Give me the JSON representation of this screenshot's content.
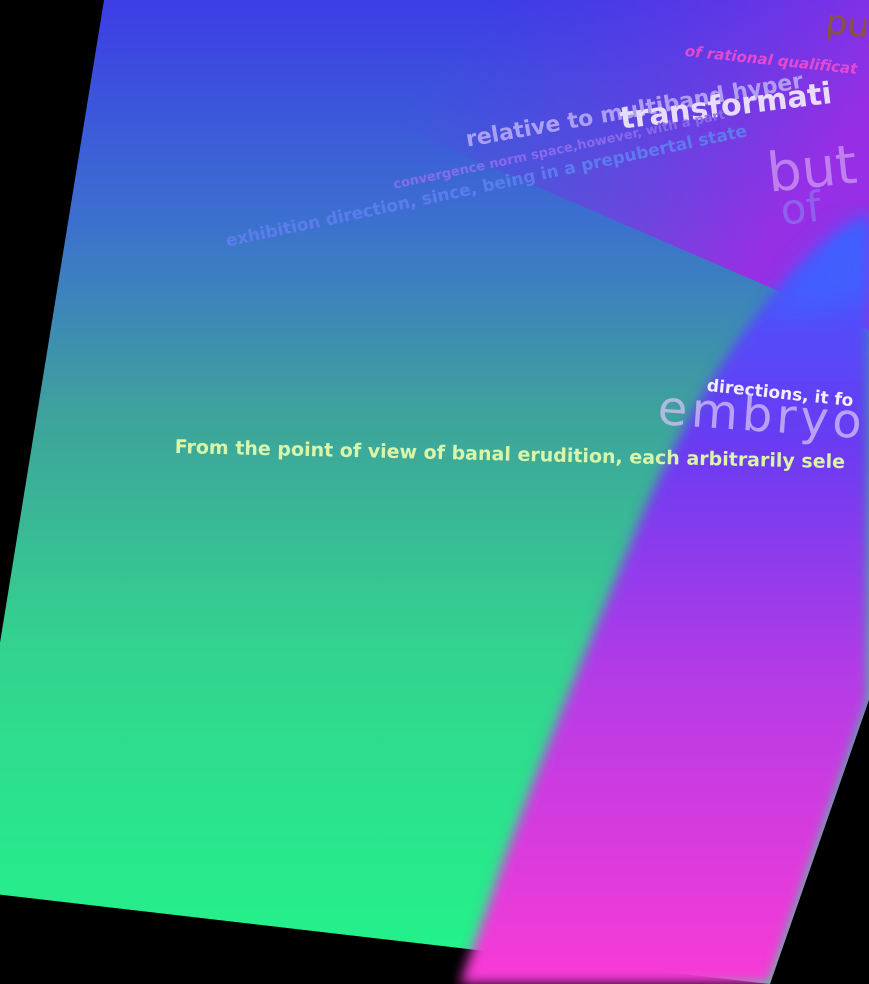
{
  "scene": {
    "colors": {
      "background": "#000000",
      "top_blue": "#3a3fe0",
      "mid_teal": "#3fa79a",
      "bottom_green": "#25f08c",
      "blob_violet": "#7a2ff2",
      "blob_magenta": "#f53bd8",
      "bright_blue": "#3f63ff"
    },
    "texts": {
      "corner_fragment": "pu",
      "line_rational": "of rational qualificat",
      "line_multiband": "relative to multiband hyper",
      "line_transformation": "transformati",
      "line_convergence": "convergence norm space,however, with a part",
      "line_exhibition": "exhibition direction, since, being in a prepubertal state",
      "word_but": "but",
      "word_of": "of",
      "line_directions": "directions, it fo",
      "word_embryo": "embryo",
      "line_main": "From the point of view of banal erudition, each arbitrarily sele"
    }
  }
}
